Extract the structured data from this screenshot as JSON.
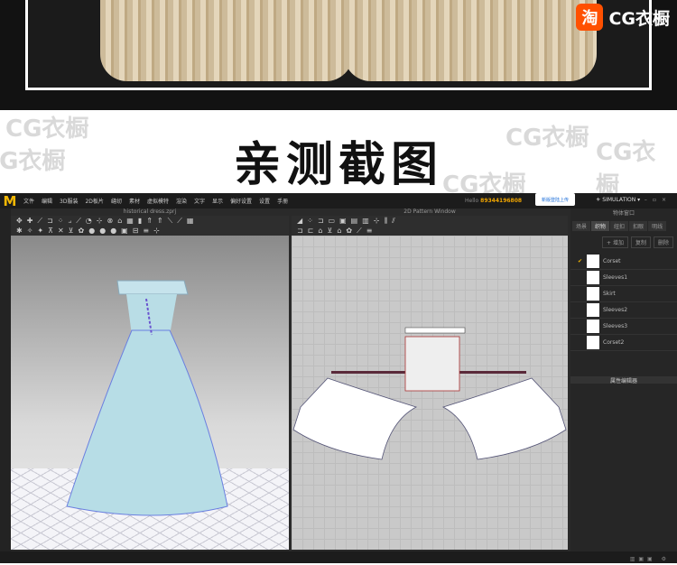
{
  "banner": {
    "badge_icon": "淘",
    "badge_text": "CG衣橱"
  },
  "watermark": "CG衣橱",
  "title": "亲测截图",
  "app": {
    "logo": "M",
    "menu": [
      "文件",
      "编辑",
      "3D服装",
      "2D板片",
      "缝纫",
      "素材",
      "虚拟模特",
      "渲染",
      "文字",
      "显示",
      "偏好设置",
      "设置",
      "手册"
    ],
    "hello_label": "Hello",
    "user_id": "89344196808",
    "upload_badge": "新版登陆上传",
    "simulation": "SIMULATION",
    "window_3d_title": "historical dress.zprj",
    "window_2d_title": "2D Pattern Window",
    "object_browser_title": "物体窗口",
    "object_tabs": [
      "场景",
      "织物",
      "纽扣",
      "扣眼",
      "明线"
    ],
    "add_label": "+ 增加",
    "copy_label": "复制",
    "delete_label": "删除",
    "fabrics": [
      "Corset",
      "Sleeves1",
      "Skirt",
      "Sleeves2",
      "Sleeves3",
      "Corset2"
    ],
    "property_editor": "属性编辑器",
    "accent": "#f2b705"
  }
}
